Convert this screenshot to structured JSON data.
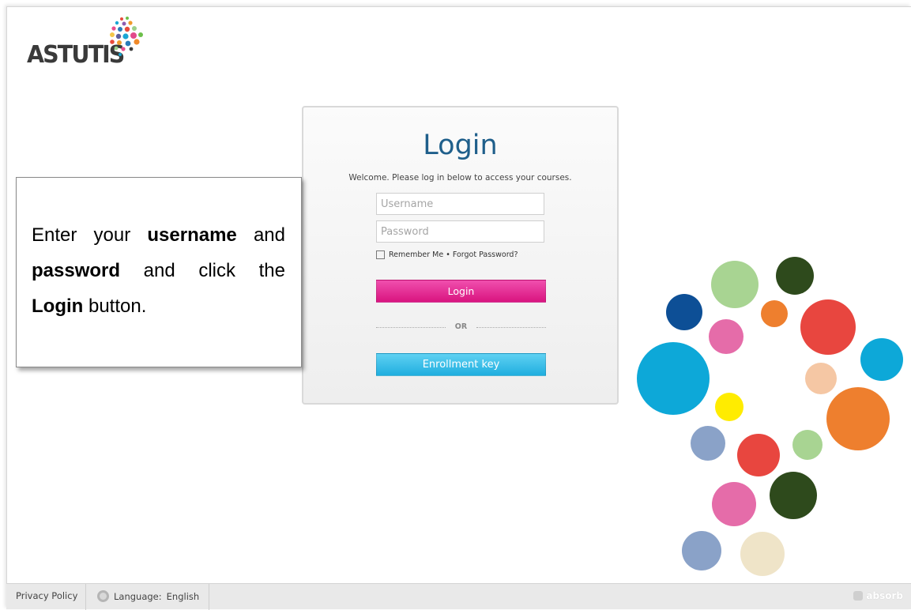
{
  "logo": {
    "text": "ASTUTIS"
  },
  "login": {
    "title": "Login",
    "welcome": "Welcome. Please log in below to access your courses.",
    "username_placeholder": "Username",
    "password_placeholder": "Password",
    "remember_label": "Remember Me",
    "bullet": "•",
    "forgot_label": "Forgot Password?",
    "login_button": "Login",
    "or_text": "OR",
    "enroll_button": "Enrollment key"
  },
  "callout": {
    "part1": "Enter your ",
    "bold1": "username",
    "part2": " and ",
    "bold2": "password",
    "part3": " and click the ",
    "bold3": "Login",
    "part4": " button."
  },
  "footer": {
    "privacy": "Privacy Policy",
    "language_label": "Language:",
    "language_value": "English",
    "brand": "absorb"
  },
  "colors": {
    "title_blue": "#1f5f8b",
    "login_pink": "#e2268e",
    "enroll_blue": "#31bfea"
  },
  "icons": [
    "globe-icon",
    "checkbox-icon",
    "absorb-logo-icon",
    "astutis-dots-icon"
  ]
}
